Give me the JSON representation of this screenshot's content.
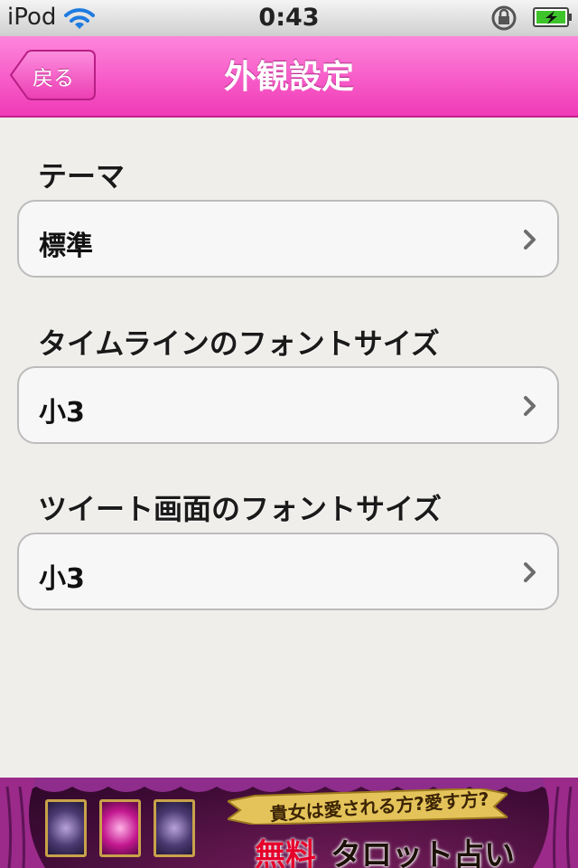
{
  "status_bar": {
    "carrier": "iPod",
    "time": "0:43"
  },
  "nav": {
    "back_label": "戻る",
    "title": "外観設定"
  },
  "sections": [
    {
      "header": "テーマ",
      "value": "標準"
    },
    {
      "header": "タイムラインのフォントサイズ",
      "value": "小3"
    },
    {
      "header": "ツイート画面のフォントサイズ",
      "value": "小3"
    }
  ],
  "ad": {
    "ribbon_text": "貴女は愛される方?愛す方?",
    "free_text": "無料",
    "tarot_text": "タロット占い"
  },
  "colors": {
    "nav_pink": "#f75bc8",
    "background": "#efeeeb",
    "ad_red": "#e5002c"
  },
  "icons": [
    "wifi-icon",
    "lock-rotation-icon",
    "battery-charging-icon",
    "chevron-right-icon"
  ]
}
